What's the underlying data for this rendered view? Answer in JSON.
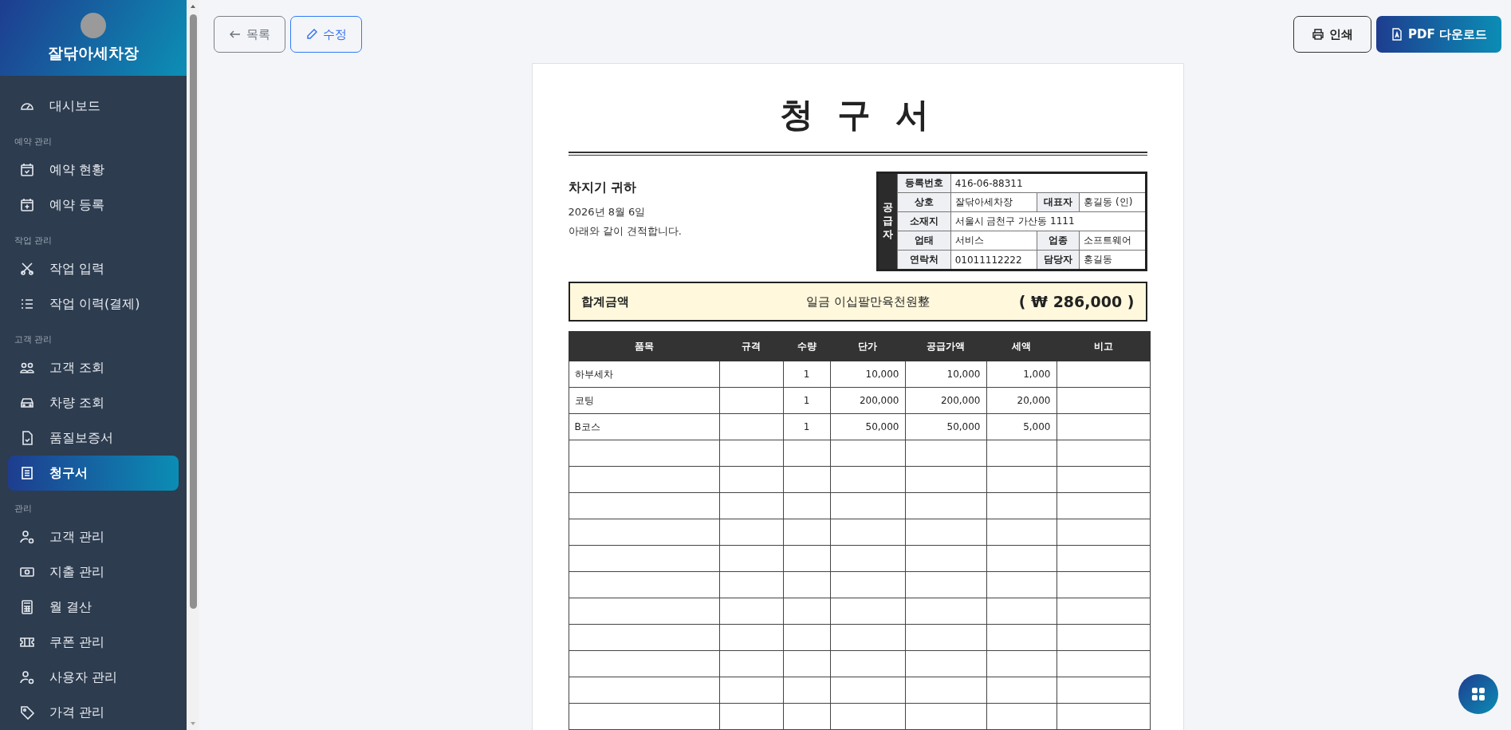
{
  "sidebar": {
    "brand": "잘닦아세차장",
    "nav": [
      {
        "kind": "item",
        "label": "대시보드",
        "selected": false
      },
      {
        "kind": "section",
        "label": "예약 관리"
      },
      {
        "kind": "item",
        "label": "예약 현황",
        "selected": false
      },
      {
        "kind": "item",
        "label": "예약 등록",
        "selected": false
      },
      {
        "kind": "section",
        "label": "작업 관리"
      },
      {
        "kind": "item",
        "label": "작업 입력",
        "selected": false
      },
      {
        "kind": "item",
        "label": "작업 이력(결제)",
        "selected": false
      },
      {
        "kind": "section",
        "label": "고객 관리"
      },
      {
        "kind": "item",
        "label": "고객 조회",
        "selected": false
      },
      {
        "kind": "item",
        "label": "차량 조회",
        "selected": false
      },
      {
        "kind": "item",
        "label": "품질보증서",
        "selected": false
      },
      {
        "kind": "item",
        "label": "청구서",
        "selected": true
      },
      {
        "kind": "section",
        "label": "관리"
      },
      {
        "kind": "item",
        "label": "고객 관리",
        "selected": false
      },
      {
        "kind": "item",
        "label": "지출 관리",
        "selected": false
      },
      {
        "kind": "item",
        "label": "월 결산",
        "selected": false
      },
      {
        "kind": "item",
        "label": "쿠폰 관리",
        "selected": false
      },
      {
        "kind": "item",
        "label": "사용자 관리",
        "selected": false
      },
      {
        "kind": "item",
        "label": "가격 관리",
        "selected": false
      }
    ]
  },
  "toolbar": {
    "left": [
      {
        "kind": "back",
        "label": "목록"
      },
      {
        "kind": "edit",
        "label": "수정"
      }
    ],
    "right": [
      {
        "kind": "print",
        "label": "인쇄"
      },
      {
        "kind": "pdf",
        "label": "PDF 다운로드"
      }
    ]
  },
  "document": {
    "title": "청 구 서",
    "recipient": "차지기 귀하",
    "date": "2026년 8월 6일",
    "note": "아래와 같이 견적합니다.",
    "supplier": {
      "heading": "공급자",
      "rows": [
        [
          {
            "label": "등록번호",
            "value": "416-06-88311"
          }
        ],
        [
          {
            "label": "상호",
            "value": "잘닦아세차장"
          },
          {
            "label": "대표자",
            "value": "홍길동 (인)"
          }
        ],
        [
          {
            "label": "소재지",
            "value": "서울시 금천구 가산동 1111"
          }
        ],
        [
          {
            "label": "업태",
            "value": "서비스"
          },
          {
            "label": "업종",
            "value": "소프트웨어"
          }
        ],
        [
          {
            "label": "연락처",
            "value": "01011112222"
          },
          {
            "label": "담당자",
            "value": "홍길동"
          }
        ]
      ]
    },
    "total": {
      "label": "합계금액",
      "words": "일금 이십팔만육천원整",
      "amount": "( ₩ 286,000 )"
    },
    "items": {
      "columns": [
        "품목",
        "규격",
        "수량",
        "단가",
        "공급가액",
        "세액",
        "비고"
      ],
      "rows": [
        {
          "item": "하부세차",
          "qty": "1",
          "unit_price": "10,000",
          "supply": "10,000",
          "tax": "1,000"
        },
        {
          "item": "코팅",
          "qty": "1",
          "unit_price": "200,000",
          "supply": "200,000",
          "tax": "20,000"
        },
        {
          "item": "B코스",
          "qty": "1",
          "unit_price": "50,000",
          "supply": "50,000",
          "tax": "5,000"
        }
      ]
    }
  }
}
